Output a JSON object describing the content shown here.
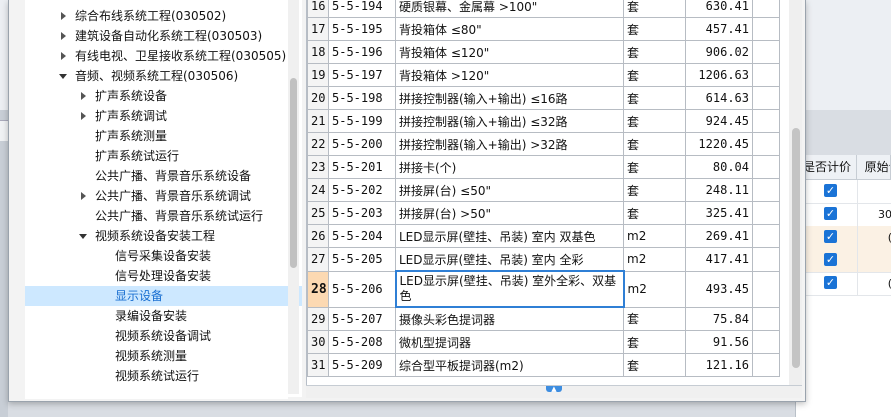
{
  "tree": {
    "items": [
      {
        "label": "综合布线系统工程(030502)",
        "level": 1,
        "arrow": "collapsed"
      },
      {
        "label": "建筑设备自动化系统工程(030503)",
        "level": 1,
        "arrow": "collapsed"
      },
      {
        "label": "有线电视、卫星接收系统工程(030505)",
        "level": 1,
        "arrow": "collapsed"
      },
      {
        "label": "音频、视频系统工程(030506)",
        "level": 1,
        "arrow": "expanded"
      },
      {
        "label": "扩声系统设备",
        "level": 2,
        "arrow": "collapsed"
      },
      {
        "label": "扩声系统调试",
        "level": 2,
        "arrow": "collapsed"
      },
      {
        "label": "扩声系统测量",
        "level": 2,
        "arrow": "none"
      },
      {
        "label": "扩声系统试运行",
        "level": 2,
        "arrow": "none"
      },
      {
        "label": "公共广播、背景音乐系统设备",
        "level": 2,
        "arrow": "none"
      },
      {
        "label": "公共广播、背景音乐系统调试",
        "level": 2,
        "arrow": "collapsed"
      },
      {
        "label": "公共广播、背景音乐系统试运行",
        "level": 2,
        "arrow": "none"
      },
      {
        "label": "视频系统设备安装工程",
        "level": 2,
        "arrow": "expanded"
      },
      {
        "label": "信号采集设备安装",
        "level": 3,
        "arrow": "none"
      },
      {
        "label": "信号处理设备安装",
        "level": 3,
        "arrow": "none"
      },
      {
        "label": "显示设备",
        "level": 3,
        "arrow": "none",
        "selected": true
      },
      {
        "label": "录编设备安装",
        "level": 3,
        "arrow": "none"
      },
      {
        "label": "视频系统设备调试",
        "level": 3,
        "arrow": "none"
      },
      {
        "label": "视频系统测量",
        "level": 3,
        "arrow": "none"
      },
      {
        "label": "视频系统试运行",
        "level": 3,
        "arrow": "none"
      }
    ]
  },
  "grid": {
    "rows": [
      {
        "num": "16",
        "code": "5-5-194",
        "name": "硬质银幕、金属幕 >100\"",
        "unit": "套",
        "price": "630.41"
      },
      {
        "num": "17",
        "code": "5-5-195",
        "name": "背投箱体 ≤80\"",
        "unit": "套",
        "price": "457.41"
      },
      {
        "num": "18",
        "code": "5-5-196",
        "name": "背投箱体 ≤120\"",
        "unit": "套",
        "price": "906.02"
      },
      {
        "num": "19",
        "code": "5-5-197",
        "name": "背投箱体 >120\"",
        "unit": "套",
        "price": "1206.63"
      },
      {
        "num": "20",
        "code": "5-5-198",
        "name": "拼接控制器(输入+输出) ≤16路",
        "unit": "套",
        "price": "614.63"
      },
      {
        "num": "21",
        "code": "5-5-199",
        "name": "拼接控制器(输入+输出) ≤32路",
        "unit": "套",
        "price": "924.45"
      },
      {
        "num": "22",
        "code": "5-5-200",
        "name": "拼接控制器(输入+输出) >32路",
        "unit": "套",
        "price": "1220.45"
      },
      {
        "num": "23",
        "code": "5-5-201",
        "name": "拼接卡(个)",
        "unit": "套",
        "price": "80.04"
      },
      {
        "num": "24",
        "code": "5-5-202",
        "name": "拼接屏(台) ≤50\"",
        "unit": "套",
        "price": "248.11"
      },
      {
        "num": "25",
        "code": "5-5-203",
        "name": "拼接屏(台) >50\"",
        "unit": "套",
        "price": "325.41"
      },
      {
        "num": "26",
        "code": "5-5-204",
        "name": "LED显示屏(壁挂、吊装) 室内 双基色",
        "unit": "m2",
        "price": "269.41"
      },
      {
        "num": "27",
        "code": "5-5-205",
        "name": "LED显示屏(壁挂、吊装) 室内 全彩",
        "unit": "m2",
        "price": "417.41"
      },
      {
        "num": "28",
        "code": "5-5-206",
        "name": "LED显示屏(壁挂、吊装) 室外全彩、双基色",
        "unit": "m2",
        "price": "493.45",
        "active": true
      },
      {
        "num": "29",
        "code": "5-5-207",
        "name": "摄像头彩色提词器",
        "unit": "套",
        "price": "75.84"
      },
      {
        "num": "30",
        "code": "5-5-208",
        "name": "微机型提词器",
        "unit": "套",
        "price": "91.56"
      },
      {
        "num": "31",
        "code": "5-5-209",
        "name": "综合型平板提词器(m2)",
        "unit": "套",
        "price": "121.16"
      }
    ]
  },
  "background": {
    "col_charge": "是否计价",
    "col_price": "原始合",
    "rows": [
      {
        "checked": true,
        "value": "",
        "shade": false
      },
      {
        "checked": true,
        "value": "30",
        "shade": false
      },
      {
        "checked": true,
        "value": "(",
        "shade": true
      },
      {
        "checked": true,
        "value": "",
        "shade": true
      },
      {
        "checked": true,
        "value": "(",
        "shade": false
      }
    ]
  }
}
